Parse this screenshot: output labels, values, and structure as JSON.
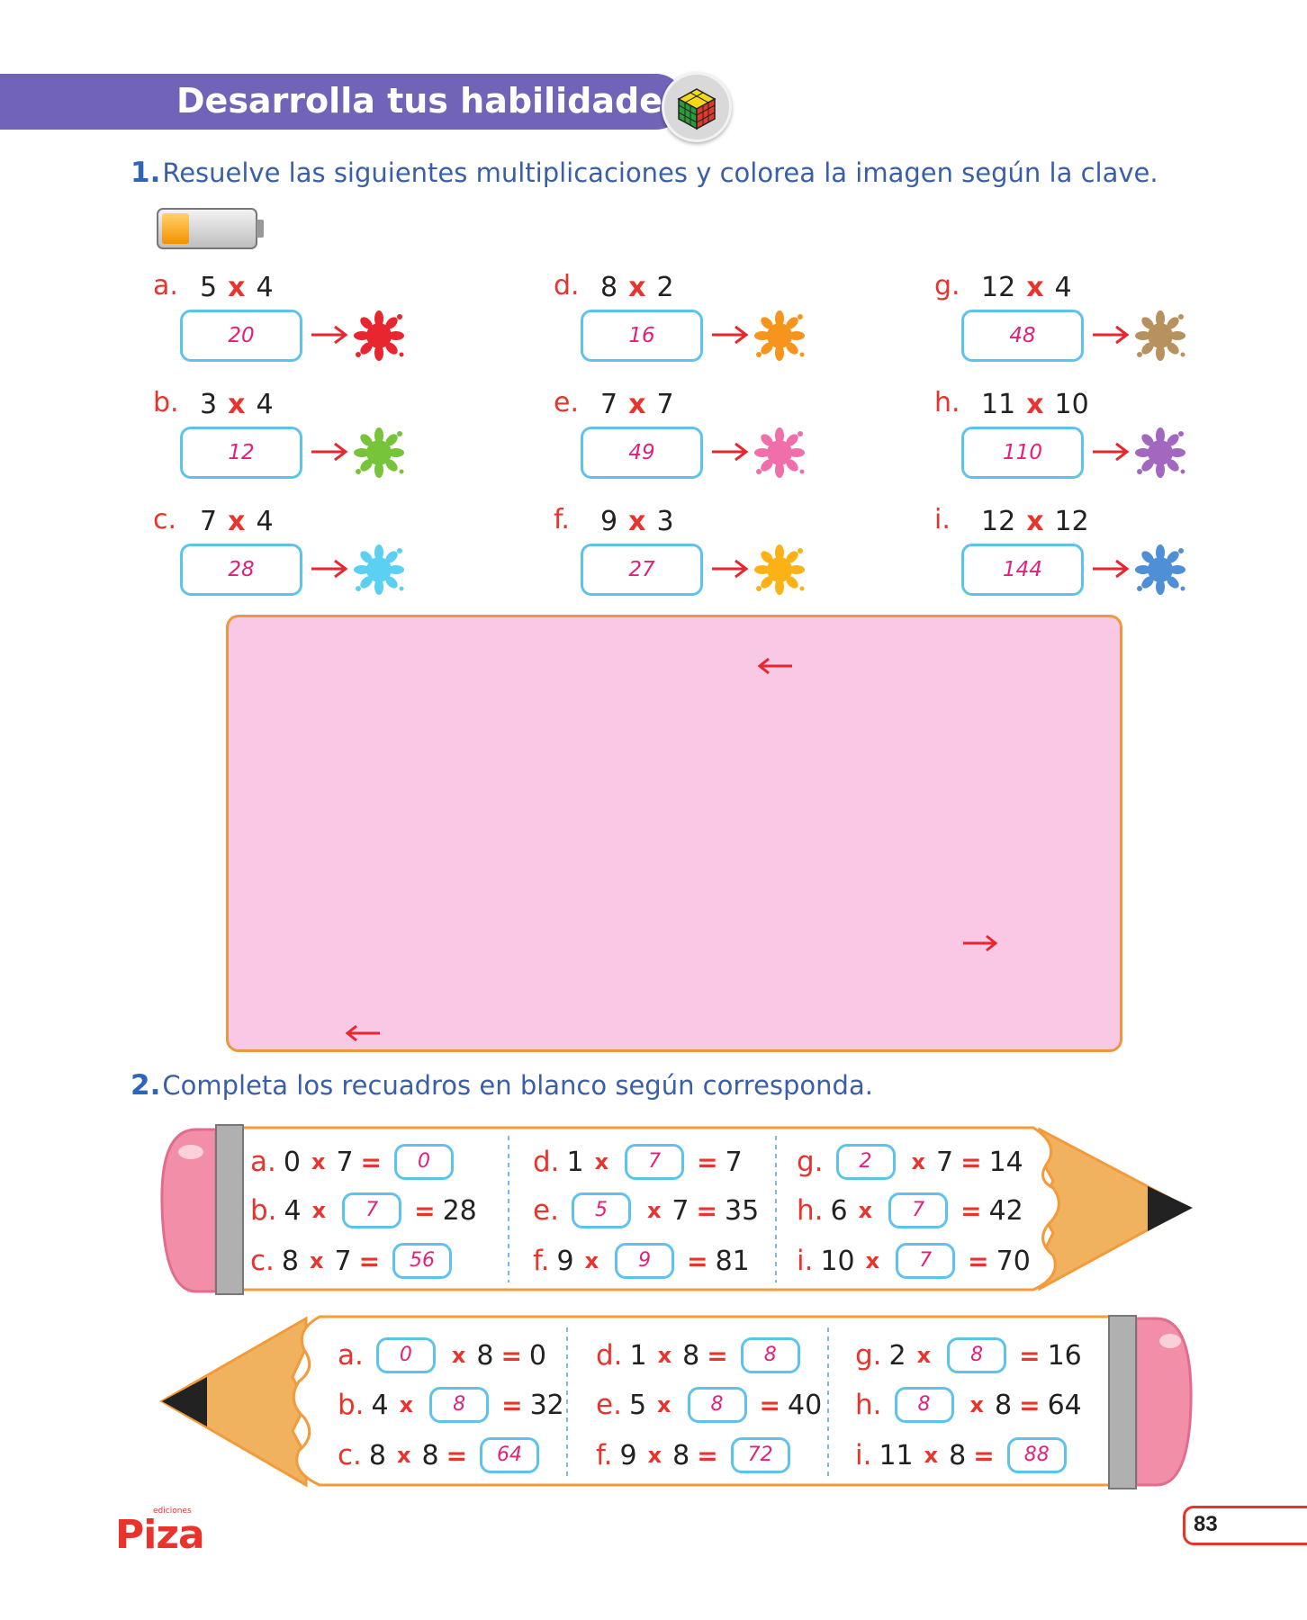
{
  "header": {
    "title": "Desarrolla tus habilidades",
    "icon": "rubiks-cube-icon"
  },
  "q1": {
    "number": "1.",
    "instruction": "Resuelve las siguientes multiplicaciones y colorea la imagen según la clave.",
    "battery_level": 0.3,
    "items": [
      {
        "letter": "a.",
        "a": "5",
        "b": "4",
        "answer": "20",
        "color": "#e8262f"
      },
      {
        "letter": "b.",
        "a": "3",
        "b": "4",
        "answer": "12",
        "color": "#77c43a"
      },
      {
        "letter": "c.",
        "a": "7",
        "b": "4",
        "answer": "28",
        "color": "#5cd0f3"
      },
      {
        "letter": "d.",
        "a": "8",
        "b": "2",
        "answer": "16",
        "color": "#f7941d"
      },
      {
        "letter": "e.",
        "a": "7",
        "b": "7",
        "answer": "49",
        "color": "#f06eaa"
      },
      {
        "letter": "f.",
        "a": "9",
        "b": "3",
        "answer": "27",
        "color": "#fbb216"
      },
      {
        "letter": "g.",
        "a": "12",
        "b": "4",
        "answer": "48",
        "color": "#b8925e"
      },
      {
        "letter": "h.",
        "a": "11",
        "b": "10",
        "answer": "110",
        "color": "#a268c0"
      },
      {
        "letter": "i.",
        "a": "12",
        "b": "12",
        "answer": "144",
        "color": "#4f8fd6"
      }
    ],
    "operator": "x",
    "canvas_color": "#f8c8e5"
  },
  "q2": {
    "number": "2.",
    "instruction": "Completa los recuadros en blanco según corresponda.",
    "pencil1": {
      "col1": [
        {
          "letter": "a.",
          "a": "0",
          "b": "7",
          "r": "0"
        },
        {
          "letter": "b.",
          "a": "4",
          "b": "7",
          "r": "28"
        },
        {
          "letter": "c.",
          "a": "8",
          "b": "7",
          "r": "56"
        }
      ],
      "col2": [
        {
          "letter": "d.",
          "a": "1",
          "b": "7",
          "r": "7"
        },
        {
          "letter": "e.",
          "a": "5",
          "b": "7",
          "r": "35"
        },
        {
          "letter": "f.",
          "a": "9",
          "b": "9",
          "r": "81"
        }
      ],
      "col3": [
        {
          "letter": "g.",
          "a": "2",
          "b": "7",
          "r": "14"
        },
        {
          "letter": "h.",
          "a": "6",
          "b": "7",
          "r": "42"
        },
        {
          "letter": "i.",
          "a": "10",
          "b": "7",
          "r": "70"
        }
      ]
    },
    "pencil2": {
      "col1": [
        {
          "letter": "a.",
          "a": "0",
          "b": "8",
          "r": "0"
        },
        {
          "letter": "b.",
          "a": "4",
          "b": "8",
          "r": "32"
        },
        {
          "letter": "c.",
          "a": "8",
          "b": "8",
          "r": "64"
        }
      ],
      "col2": [
        {
          "letter": "d.",
          "a": "1",
          "b": "8",
          "r": "8"
        },
        {
          "letter": "e.",
          "a": "5",
          "b": "8",
          "r": "40"
        },
        {
          "letter": "f.",
          "a": "9",
          "b": "8",
          "r": "72"
        }
      ],
      "col3": [
        {
          "letter": "g.",
          "a": "2",
          "b": "8",
          "r": "16"
        },
        {
          "letter": "h.",
          "a": "8",
          "b": "8",
          "r": "64"
        },
        {
          "letter": "i.",
          "a": "11",
          "b": "8",
          "r": "88"
        }
      ]
    },
    "eq": "="
  },
  "footer": {
    "logo_small": "ediciones",
    "logo": "Piza",
    "page": "83"
  }
}
